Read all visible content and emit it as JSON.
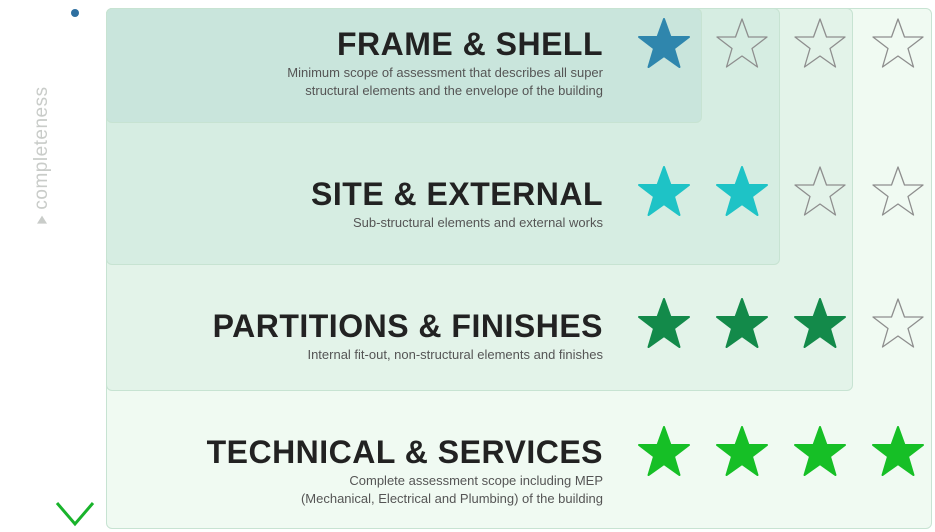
{
  "axis": {
    "label": "completeness",
    "gradient": [
      "#2e6fa0",
      "#1aa9b5",
      "#12884a",
      "#19b32b"
    ]
  },
  "tiers": [
    {
      "title": "FRAME & SHELL",
      "description": [
        "Minimum scope of assessment that describes all super",
        "structural elements and the envelope of the building"
      ],
      "stars_filled": 1,
      "stars_total": 4,
      "star_color": "#2f86ad"
    },
    {
      "title": "SITE & EXTERNAL",
      "description": [
        "Sub-structural elements and external works"
      ],
      "stars_filled": 2,
      "stars_total": 4,
      "star_color": "#1ec3c6"
    },
    {
      "title": "PARTITIONS & FINISHES",
      "description": [
        "Internal fit-out, non-structural elements and finishes"
      ],
      "stars_filled": 3,
      "stars_total": 4,
      "star_color": "#138a4a"
    },
    {
      "title": "TECHNICAL & SERVICES",
      "description": [
        "Complete assessment scope including MEP",
        "(Mechanical, Electrical and Plumbing) of the building"
      ],
      "stars_filled": 4,
      "stars_total": 4,
      "star_color": "#16bf26"
    }
  ]
}
